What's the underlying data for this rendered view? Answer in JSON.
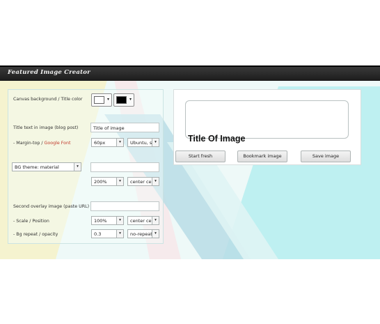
{
  "app": {
    "title": "Featured Image Creator"
  },
  "colors": {
    "canvas_background": "#ffffff",
    "title_color": "#000000"
  },
  "form": {
    "canvas_label": "Canvas background / Title color",
    "title_text_label": "Title text in image (blog post)",
    "title_text_value": "Title of image",
    "margin_label_prefix": "- Margin-top / ",
    "margin_label_link": "Google Font",
    "margin_value": "60px",
    "font_value": "Ubuntu, sa",
    "bg_theme_value": "BG theme: material",
    "bg_size_value": "200%",
    "bg_position_value": "center cen",
    "overlay_label": "Second overlay image (paste URL)",
    "scale_label": "- Scale / Position",
    "scale_value": "100%",
    "overlay_position_value": "center cen",
    "repeat_label": "- Bg repeat / opacity",
    "opacity_value": "0.3",
    "repeat_value": "no-repeat"
  },
  "preview": {
    "title_text": "Title Of Image"
  },
  "buttons": {
    "start_fresh": "Start fresh",
    "bookmark": "Bookmark image",
    "save": "Save image"
  },
  "icons": {
    "dropdown": "▾"
  }
}
